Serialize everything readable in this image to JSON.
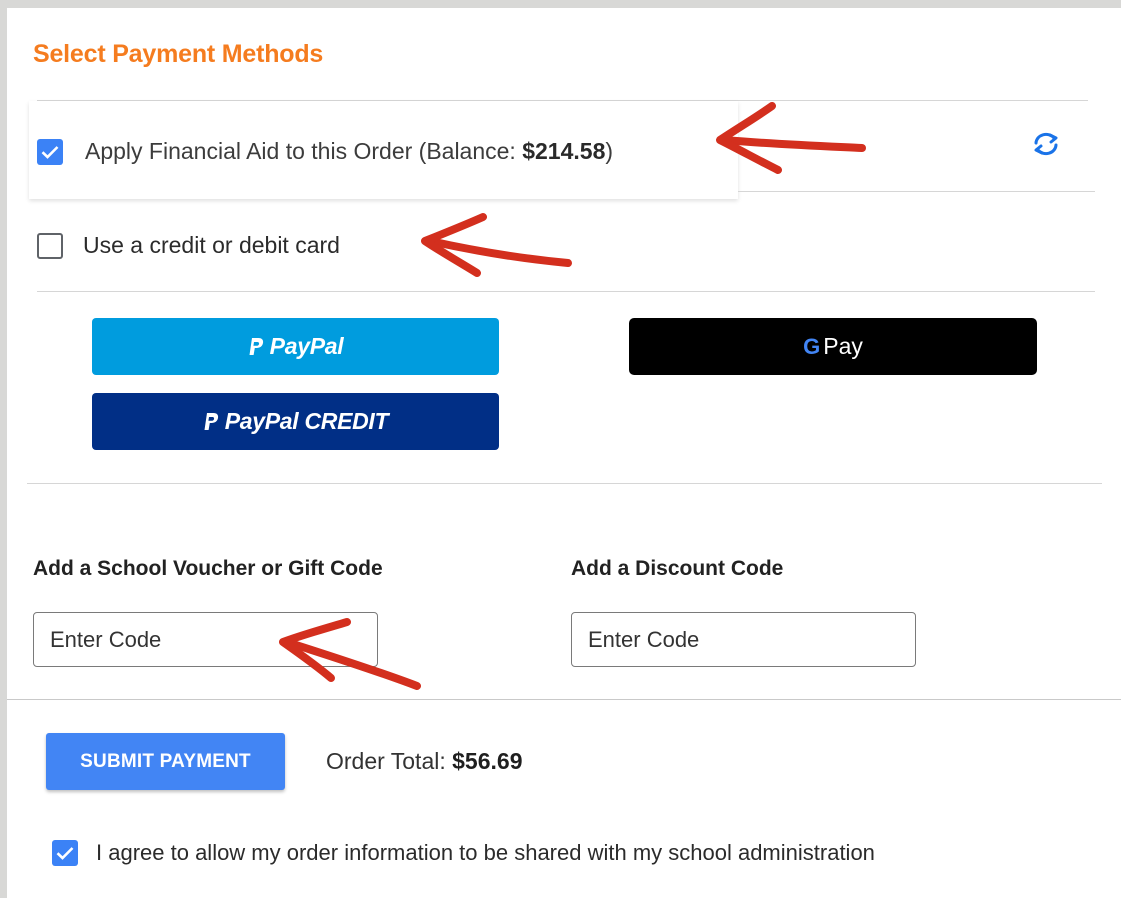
{
  "header": {
    "title": "Select Payment Methods"
  },
  "financial_aid": {
    "checked": true,
    "label_prefix": "Apply Financial Aid to this Order (Balance: ",
    "balance": "$214.58",
    "label_suffix": ")",
    "refresh_icon": "refresh-icon"
  },
  "credit_card": {
    "checked": false,
    "label": "Use a credit or debit card"
  },
  "wallets": {
    "paypal_label": "PayPal",
    "paypal_credit_label": "PayPal CREDIT",
    "gpay_g": "G",
    "gpay_label": "Pay"
  },
  "codes": {
    "voucher_label": "Add a School Voucher or Gift Code",
    "voucher_placeholder": "Enter Code",
    "discount_label": "Add a Discount Code",
    "discount_placeholder": "Enter Code"
  },
  "footer": {
    "submit_label": "SUBMIT PAYMENT",
    "total_label": "Order Total: ",
    "total_value": "$56.69",
    "agree_checked": true,
    "agree_label": "I agree to allow my order information to be shared with my school administration"
  },
  "colors": {
    "title": "#f57c1f",
    "checkbox": "#3b82f6",
    "paypal": "#009cde",
    "paypal_credit": "#012f86",
    "gpay": "#000000",
    "submit": "#4285f4",
    "annotation_arrow": "#d32f1e"
  }
}
